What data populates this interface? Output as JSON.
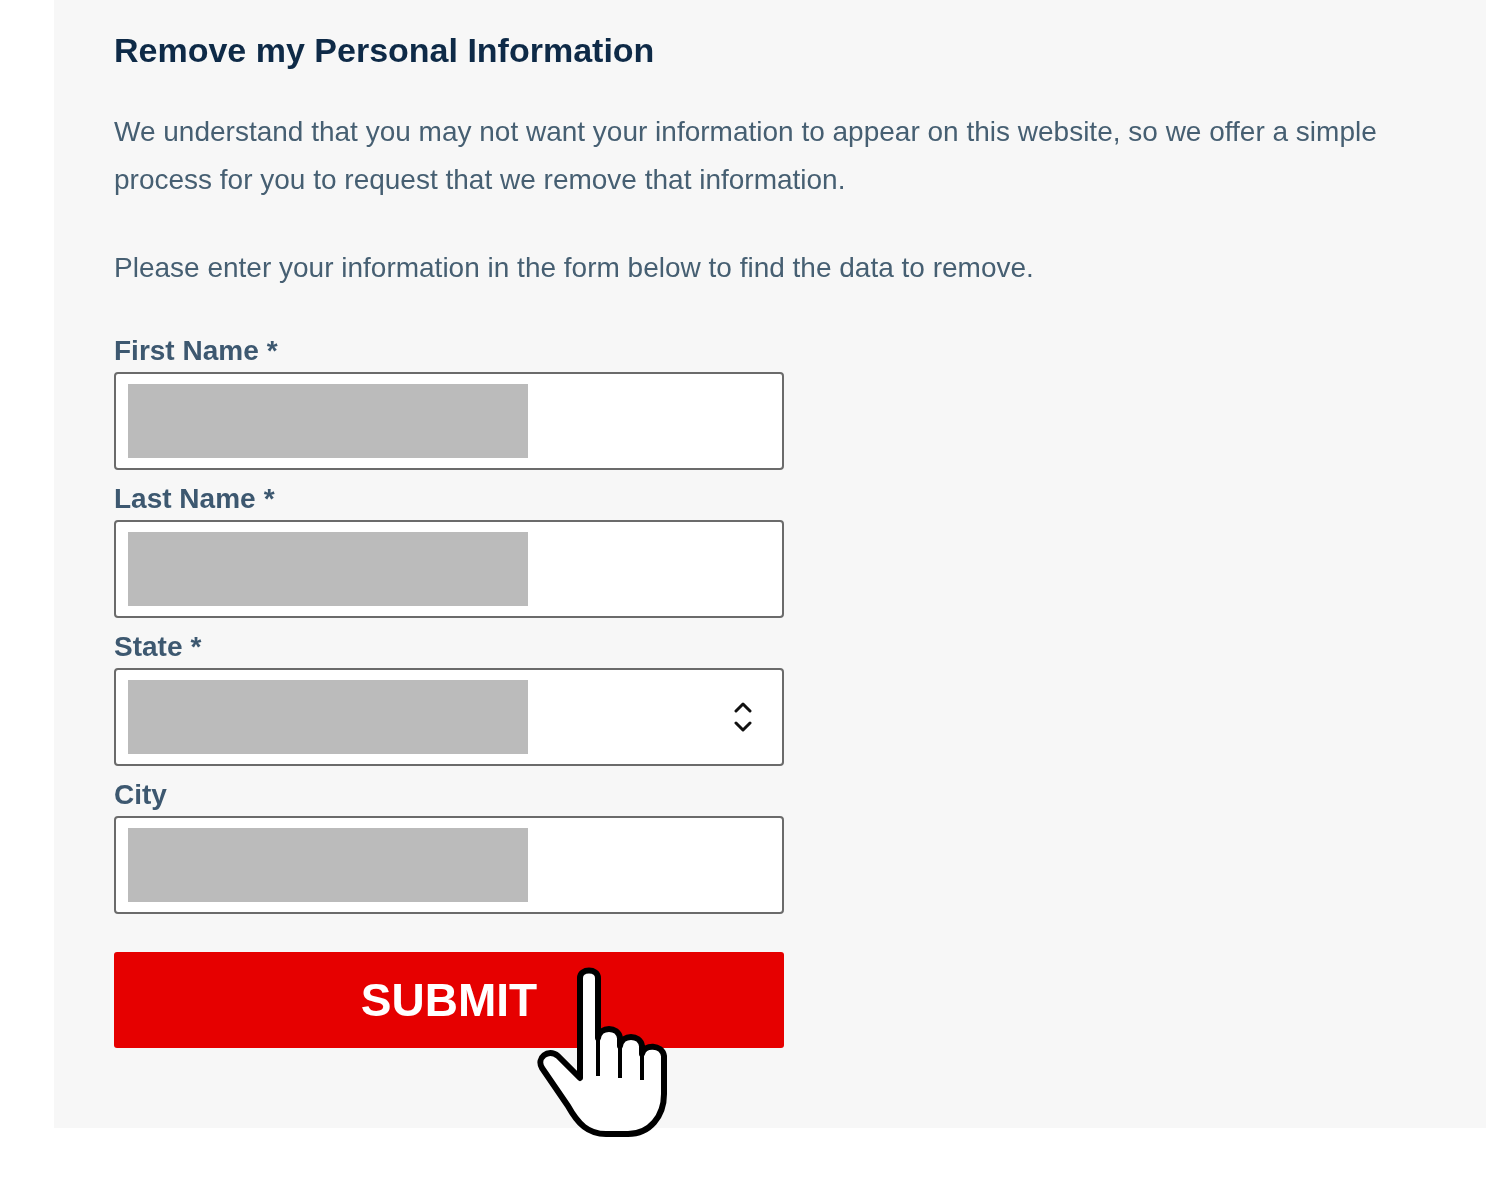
{
  "title": "Remove my Personal Information",
  "paragraphs": [
    "We understand that you may not want your information to appear on this website, so we offer a simple process for you to request that we remove that information.",
    "Please enter your information in the form below to find the data to remove."
  ],
  "fields": [
    {
      "label": "First Name",
      "required_mark": "*",
      "kind": "text",
      "redacted": true
    },
    {
      "label": "Last Name",
      "required_mark": "*",
      "kind": "text",
      "redacted": true
    },
    {
      "label": "State",
      "required_mark": "*",
      "kind": "select",
      "redacted": true
    },
    {
      "label": "City",
      "kind": "text",
      "redacted": true
    }
  ],
  "submit": {
    "label": "SUBMIT",
    "hovered": true
  }
}
